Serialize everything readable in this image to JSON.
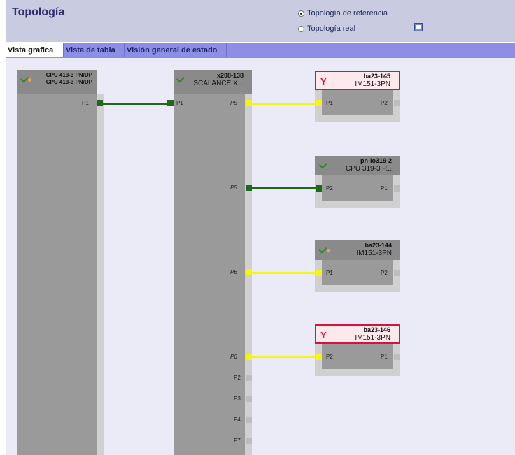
{
  "header": {
    "title": "Topología",
    "radio_reference": "Topología de referencia",
    "radio_real": "Topología real",
    "selected": "reference"
  },
  "tabs": [
    {
      "label": "Vista grafica",
      "active": true
    },
    {
      "label": "Vista de tabla",
      "active": false
    },
    {
      "label": "Visión general de estado",
      "active": false
    }
  ],
  "devices": {
    "cpu413": {
      "name": "CPU 413-3 PN/DP",
      "type": "CPU 413-3 PN/DP",
      "status": "ok-warning",
      "port_p1": "P1"
    },
    "x208": {
      "name": "x208-138",
      "type": "SCALANCE X...",
      "status": "ok",
      "port_p1": "P1",
      "port_p5a": "P5",
      "port_p5b": "P5",
      "port_p6a": "P6",
      "port_p6b": "P6",
      "port_p2": "P2",
      "port_p3": "P3",
      "port_p4": "P4",
      "port_p7": "P7"
    },
    "ba145": {
      "name": "ba23-145",
      "type": "IM151-3PN",
      "status": "error",
      "port_left": "P1",
      "port_right": "P2"
    },
    "pnio": {
      "name": "pn-io319-2",
      "type": "CPU 319-3 P...",
      "status": "ok",
      "port_left": "P2",
      "port_right": "P1"
    },
    "ba144": {
      "name": "ba23-144",
      "type": "IM151-3PN",
      "status": "ok-warning",
      "port_left": "P1",
      "port_right": "P2"
    },
    "ba146": {
      "name": "ba23-146",
      "type": "IM151-3PN",
      "status": "error",
      "port_left": "P2",
      "port_right": "P1"
    }
  },
  "colors": {
    "link_ok": "#1f6a1a",
    "link_warn": "#f5f514",
    "error_border": "#d4143c",
    "tab_bar": "#8d8fe6"
  }
}
